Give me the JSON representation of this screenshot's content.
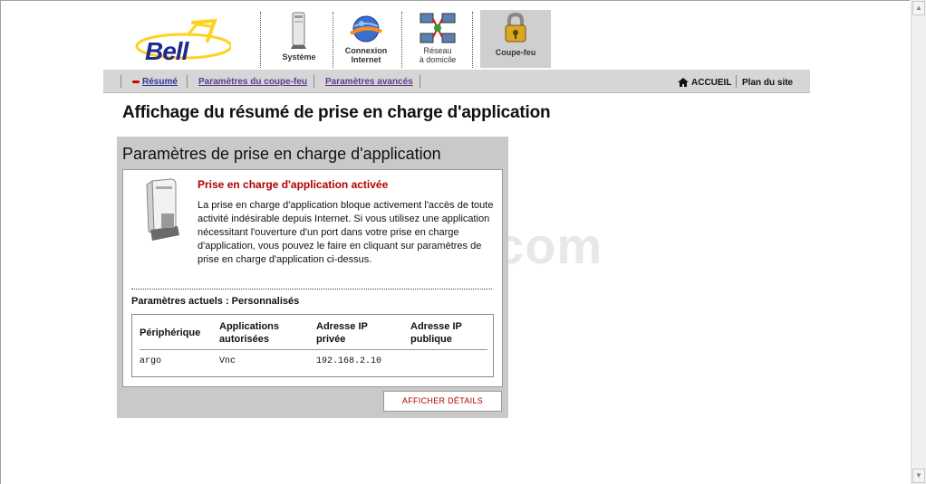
{
  "brand": {
    "logo_text": "Bell",
    "accent_color": "#ffd21f",
    "text_color": "#1f2a8c"
  },
  "top_nav": {
    "items": [
      {
        "label": "Système",
        "icon": "computer-tower-icon"
      },
      {
        "label": "Connexion Internet",
        "line1": "Connexion",
        "line2": "Internet",
        "icon": "globe-connection-icon"
      },
      {
        "label": "Réseau à domicile",
        "line1": "Réseau",
        "line2": "à domicile",
        "icon": "network-icon"
      },
      {
        "label": "Coupe-feu",
        "icon": "padlock-icon",
        "active": true
      }
    ]
  },
  "sub_nav": {
    "items": [
      {
        "label": "Résumé",
        "current": true
      },
      {
        "label": "Paramètres du coupe-feu"
      },
      {
        "label": "Paramètres avancés"
      }
    ],
    "right": {
      "home_label": "ACCUEIL",
      "sitemap_label": "Plan du site"
    }
  },
  "page": {
    "title": "Affichage du résumé de prise en charge d'application"
  },
  "panel": {
    "title": "Paramètres de prise en charge d'application",
    "status_title": "Prise en charge d'application activée",
    "description": "La prise en charge d'application bloque activement l'accès de toute activité indésirable depuis Internet. Si vous utilisez une application nécessitant l'ouverture d'un port dans votre prise en charge d'application, vous pouvez le faire en cliquant sur paramètres de prise en charge d'application ci-dessus.",
    "current_settings_label": "Paramètres actuels : Personnalisés",
    "table": {
      "headers": [
        {
          "line1": "Périphérique",
          "line2": ""
        },
        {
          "line1": "Applications",
          "line2": "autorisées"
        },
        {
          "line1": "Adresse IP",
          "line2": "privée"
        },
        {
          "line1": "Adresse IP",
          "line2": "publique"
        }
      ],
      "rows": [
        [
          "argo",
          "Vnc",
          "192.168.2.10",
          ""
        ]
      ]
    },
    "details_button": "AFFICHER DÉTAILS"
  },
  "watermark": "ech.com"
}
